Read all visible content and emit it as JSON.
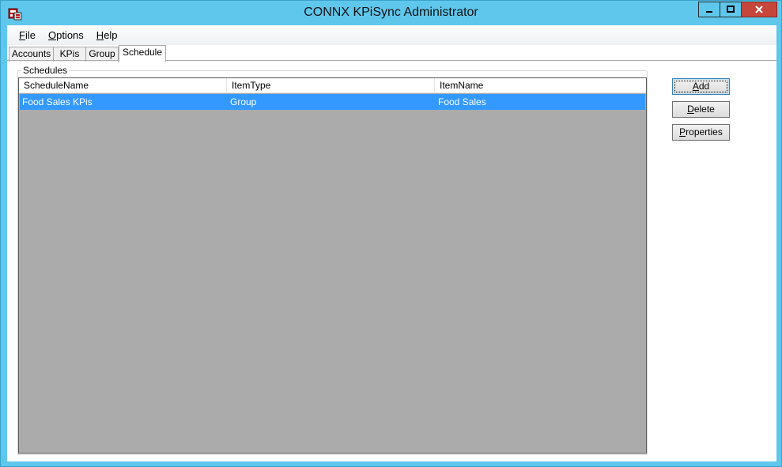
{
  "window": {
    "title": "CONNX KPiSync Administrator",
    "accent": "#5fc7ec",
    "close_color": "#c7463c"
  },
  "menu": {
    "items": [
      {
        "label": "File",
        "accel": "F",
        "rest": "ile"
      },
      {
        "label": "Options",
        "accel": "O",
        "rest": "ptions"
      },
      {
        "label": "Help",
        "accel": "H",
        "rest": "elp"
      }
    ]
  },
  "tabs": [
    {
      "label": "Accounts",
      "active": false
    },
    {
      "label": "KPis",
      "active": false
    },
    {
      "label": "Group",
      "active": false
    },
    {
      "label": "Schedule",
      "active": true
    }
  ],
  "schedules": {
    "group_label": "Schedules",
    "columns": [
      "ScheduleName",
      "ItemType",
      "ItemName"
    ],
    "rows": [
      {
        "ScheduleName": "Food Sales KPis",
        "ItemType": "Group",
        "ItemName": "Food Sales",
        "selected": true
      }
    ],
    "selection_color": "#3399ff"
  },
  "buttons": {
    "add": {
      "accel": "A",
      "rest": "dd"
    },
    "delete": {
      "accel": "D",
      "rest": "elete"
    },
    "properties": {
      "accel": "P",
      "rest": "roperties"
    }
  },
  "icons": [
    "app-icon",
    "minimize-icon",
    "maximize-icon",
    "close-icon"
  ]
}
